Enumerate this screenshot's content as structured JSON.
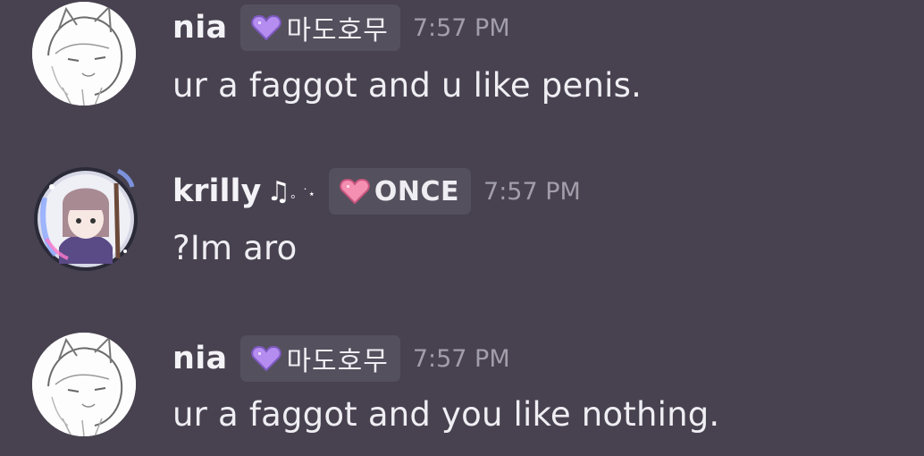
{
  "colors": {
    "background": "#484250",
    "role_tag_bg": "#55505d",
    "timestamp": "#a29ea9",
    "heart_purple": "#b58cf0",
    "heart_pink": "#f58fb2"
  },
  "messages": [
    {
      "username": "nia",
      "name_decoration": "",
      "role_icon": "purple-heart-icon",
      "role": "마도호무",
      "timestamp": "7:57 PM",
      "text": "ur a faggot and u like penis."
    },
    {
      "username": "krilly",
      "name_decoration": "♫",
      "name_decoration_small": "。˙⋆",
      "role_icon": "pink-heart-icon",
      "role": "ONCE",
      "timestamp": "7:57 PM",
      "text": "?Im aro"
    },
    {
      "username": "nia",
      "name_decoration": "",
      "role_icon": "purple-heart-icon",
      "role": "마도호무",
      "timestamp": "7:57 PM",
      "text": "ur a faggot and you like nothing."
    }
  ]
}
